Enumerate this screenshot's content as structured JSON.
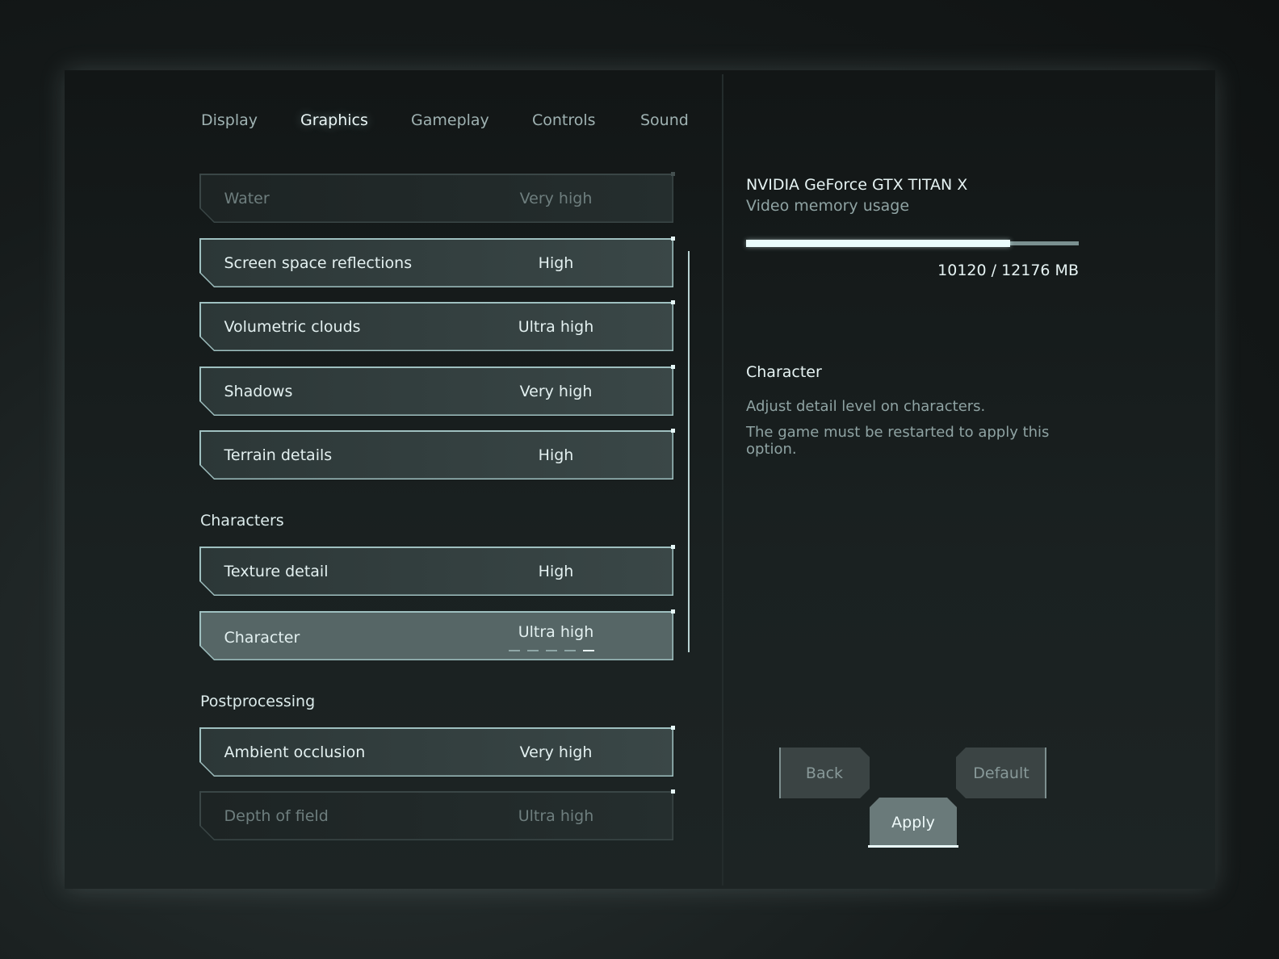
{
  "tabs": [
    {
      "label": "Display"
    },
    {
      "label": "Graphics",
      "active": true
    },
    {
      "label": "Gameplay"
    },
    {
      "label": "Controls"
    },
    {
      "label": "Sound"
    }
  ],
  "rows": [
    {
      "label": "Water",
      "value": "Very high"
    },
    {
      "label": "Screen space reflections",
      "value": "High"
    },
    {
      "label": "Volumetric clouds",
      "value": "Ultra high"
    },
    {
      "label": "Shadows",
      "value": "Very high"
    },
    {
      "label": "Terrain details",
      "value": "High"
    },
    {
      "label": "Texture detail",
      "value": "High"
    },
    {
      "label": "Character",
      "value": "Ultra high",
      "level": 5,
      "levels": 5
    },
    {
      "label": "Ambient occlusion",
      "value": "Very high"
    },
    {
      "label": "Depth of field",
      "value": "Ultra high"
    }
  ],
  "sections": {
    "characters": "Characters",
    "postprocessing": "Postprocessing"
  },
  "gpu": {
    "name": "NVIDIA GeForce GTX TITAN X",
    "subtitle": "Video memory usage",
    "used_mb": 10120,
    "total_mb": 12176,
    "usage_text": "10120 / 12176 MB",
    "usage_fraction": 0.831
  },
  "info": {
    "title": "Character",
    "line1": "Adjust detail level on characters.",
    "line2": "The game must be restarted to apply this option."
  },
  "buttons": {
    "back": "Back",
    "default": "Default",
    "apply": "Apply"
  },
  "colors": {
    "accent": "#e6f7f7",
    "bar_track": "#7a9090"
  }
}
